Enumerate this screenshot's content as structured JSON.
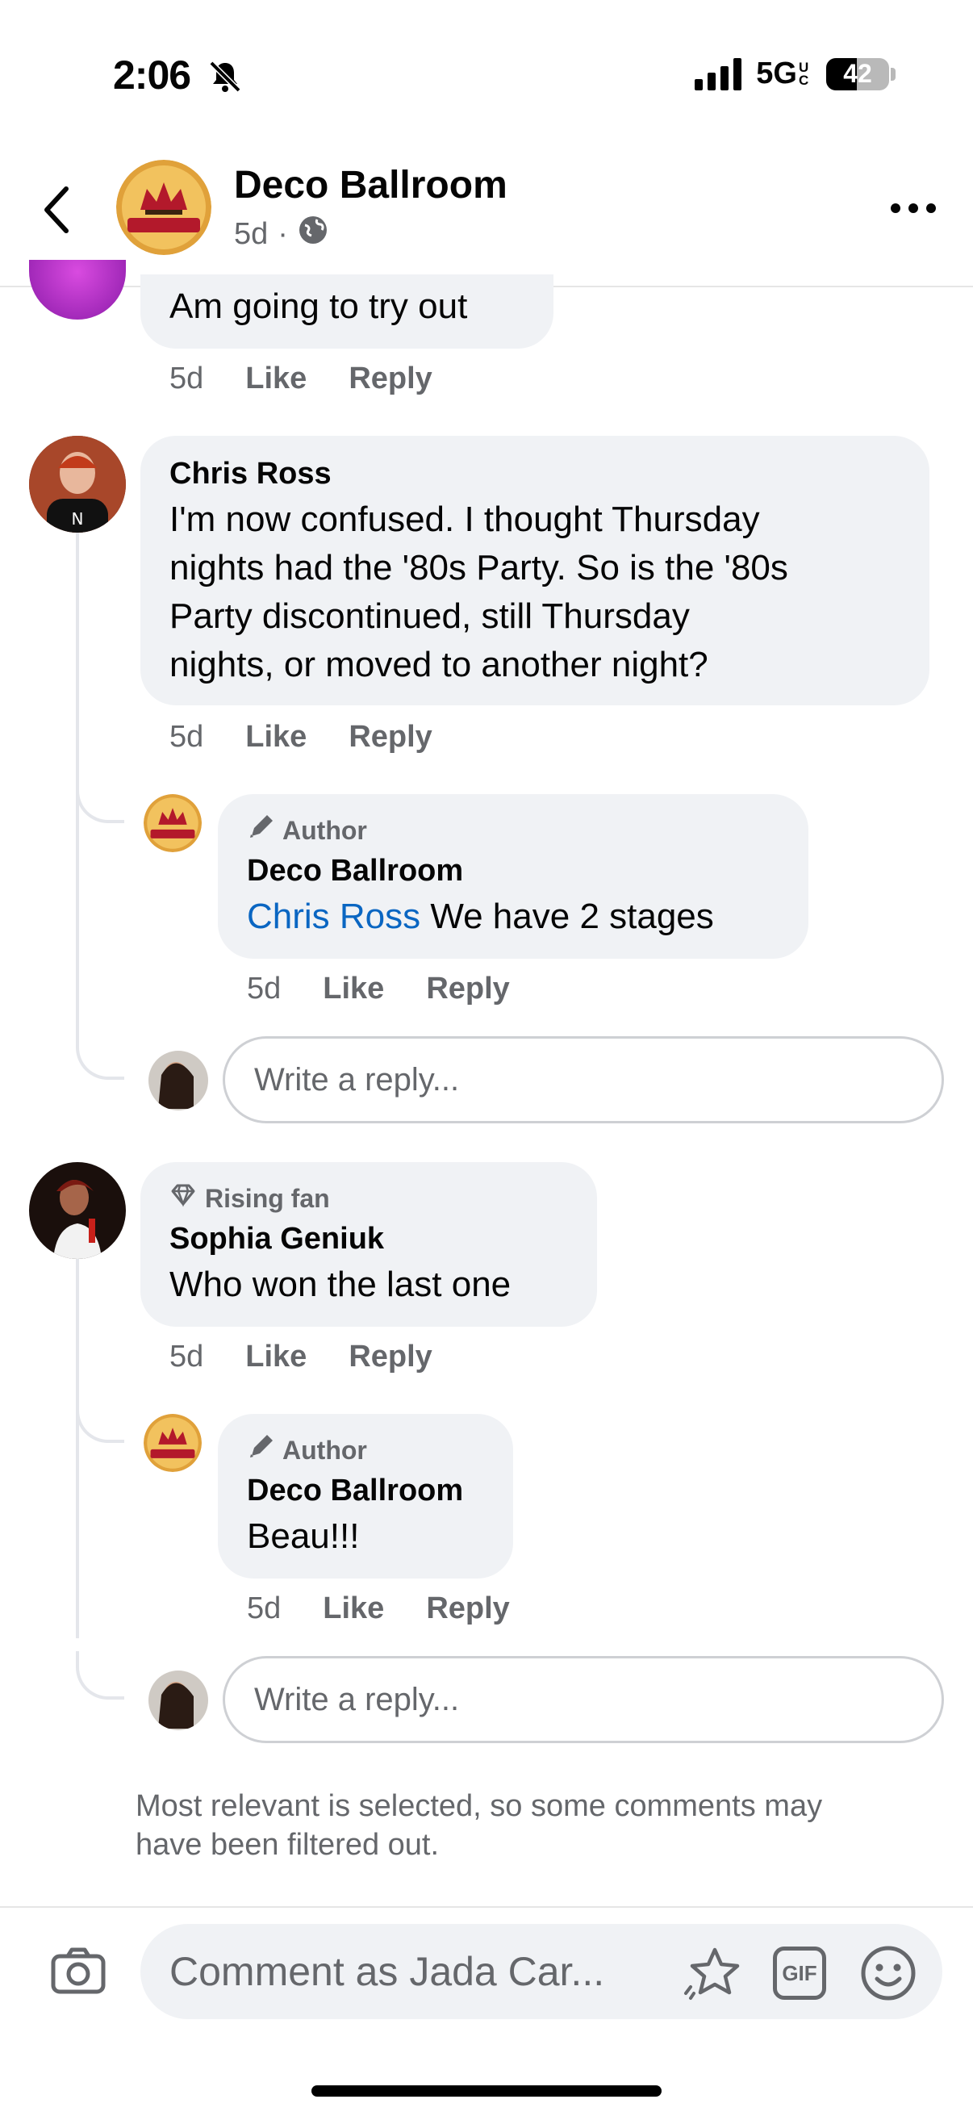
{
  "status_bar": {
    "time": "2:06",
    "network": "5G",
    "network_sub": "UC",
    "battery": "42"
  },
  "header": {
    "page_name": "Deco Ballroom",
    "time_ago": "5d",
    "separator": "·"
  },
  "comments": [
    {
      "text": "Am going to try out",
      "time": "5d",
      "like": "Like",
      "reply": "Reply"
    },
    {
      "name": "Chris Ross",
      "text_lines": [
        "I'm now confused. I thought Thursday",
        "nights had the '80s Party. So is the '80s",
        "Party discontinued, still Thursday",
        "nights, or moved to another night?"
      ],
      "time": "5d",
      "like": "Like",
      "reply": "Reply",
      "replies": [
        {
          "badge": "Author",
          "name": "Deco Ballroom",
          "mention": "Chris Ross",
          "text": " We have 2 stages",
          "time": "5d",
          "like": "Like",
          "reply": "Reply"
        }
      ]
    },
    {
      "badge": "Rising fan",
      "name": "Sophia Geniuk",
      "text": "Who won the last one",
      "time": "5d",
      "like": "Like",
      "reply": "Reply",
      "replies": [
        {
          "badge": "Author",
          "name": "Deco Ballroom",
          "text": "Beau!!!",
          "time": "5d",
          "like": "Like",
          "reply": "Reply"
        }
      ]
    }
  ],
  "reply_placeholder": "Write a reply...",
  "filter_note": "Most relevant is selected, so some comments may have been filtered out.",
  "composer": {
    "placeholder": "Comment as Jada Car...",
    "gif_label": "GIF"
  },
  "colors": {
    "link": "#0a66c2",
    "bubble": "#f0f2f5",
    "muted": "#65676b"
  },
  "icons": [
    "back-icon",
    "globe-icon",
    "more-icon",
    "pencil-icon",
    "diamond-icon",
    "camera-icon",
    "sticker-icon",
    "gif-icon",
    "emoji-icon"
  ]
}
